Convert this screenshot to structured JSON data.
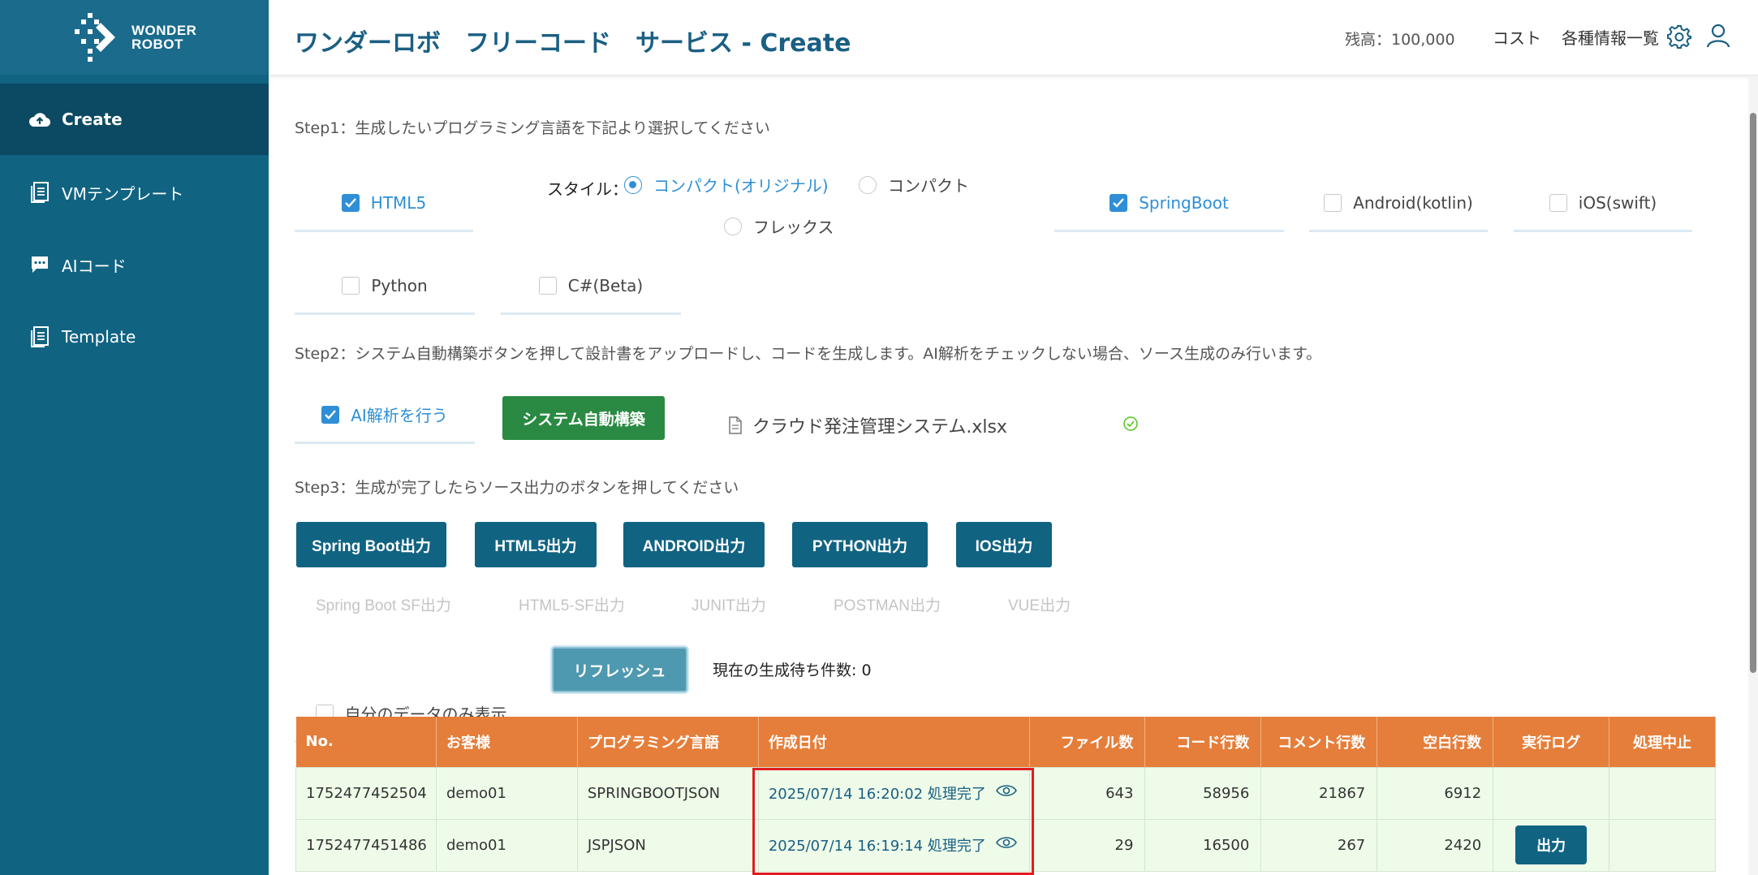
{
  "logo": {
    "line1": "WONDER",
    "line2": "ROBOT"
  },
  "sidebar": {
    "items": [
      {
        "label": "Create",
        "icon": "cloud-upload-icon",
        "active": true
      },
      {
        "label": "VMテンプレート",
        "icon": "document-icon",
        "active": false
      },
      {
        "label": "AIコード",
        "icon": "chat-icon",
        "active": false
      },
      {
        "label": "Template",
        "icon": "document-icon",
        "active": false
      }
    ]
  },
  "header": {
    "title": "ワンダーロボ　フリーコード　サービス - Create",
    "balance": "残高：100,000",
    "cost": "コスト",
    "info": "各種情報一覧"
  },
  "step1": {
    "text": "Step1：生成したいプログラミング言語を下記より選択してください",
    "html5": "HTML5",
    "style_label": "スタイル：",
    "style_options": [
      "コンパクト(オリジナル)",
      "コンパクト",
      "フレックス"
    ],
    "springboot": "SpringBoot",
    "android": "Android(kotlin)",
    "ios": "iOS(swift)",
    "python": "Python",
    "csharp": "C#(Beta)"
  },
  "step2": {
    "text": "Step2：システム自動構築ボタンを押して設計書をアップロードし、コードを生成します。AI解析をチェックしない場合、ソース生成のみ行います。",
    "ai_label": "AI解析を行う",
    "build_button": "システム自動構築",
    "file_name": "クラウド発注管理システム.xlsx"
  },
  "step3": {
    "text": "Step3：生成が完了したらソース出力のボタンを押してください",
    "buttons": [
      "Spring Boot出力",
      "HTML5出力",
      "ANDROID出力",
      "PYTHON出力",
      "IOS出力"
    ],
    "disabled_buttons": [
      "Spring Boot SF出力",
      "HTML5-SF出力",
      "JUNIT出力",
      "POSTMAN出力",
      "VUE出力"
    ],
    "own_data": "自分のデータのみ表示",
    "refresh": "リフレッシュ",
    "queue": "現在の生成待ち件数: 0"
  },
  "table": {
    "headers": [
      "No.",
      "お客様",
      "プログラミング言語",
      "作成日付",
      "ファイル数",
      "コード行数",
      "コメント行数",
      "空白行数",
      "実行ログ",
      "処理中止"
    ],
    "rows": [
      {
        "no": "1752477452504",
        "customer": "demo01",
        "lang": "SPRINGBOOTJSON",
        "date": "2025/07/14 16:20:02 処理完了",
        "files": "643",
        "code": "58956",
        "comment": "21867",
        "blank": "6912",
        "log": ""
      },
      {
        "no": "1752477451486",
        "customer": "demo01",
        "lang": "JSPJSON",
        "date": "2025/07/14 16:19:14 処理完了",
        "files": "29",
        "code": "16500",
        "comment": "267",
        "blank": "2420",
        "log": "出力"
      }
    ]
  },
  "colors": {
    "sidebar": "#116382",
    "accent": "#2e8fd6",
    "table_header": "#e57e3a",
    "green": "#2a8a43"
  }
}
